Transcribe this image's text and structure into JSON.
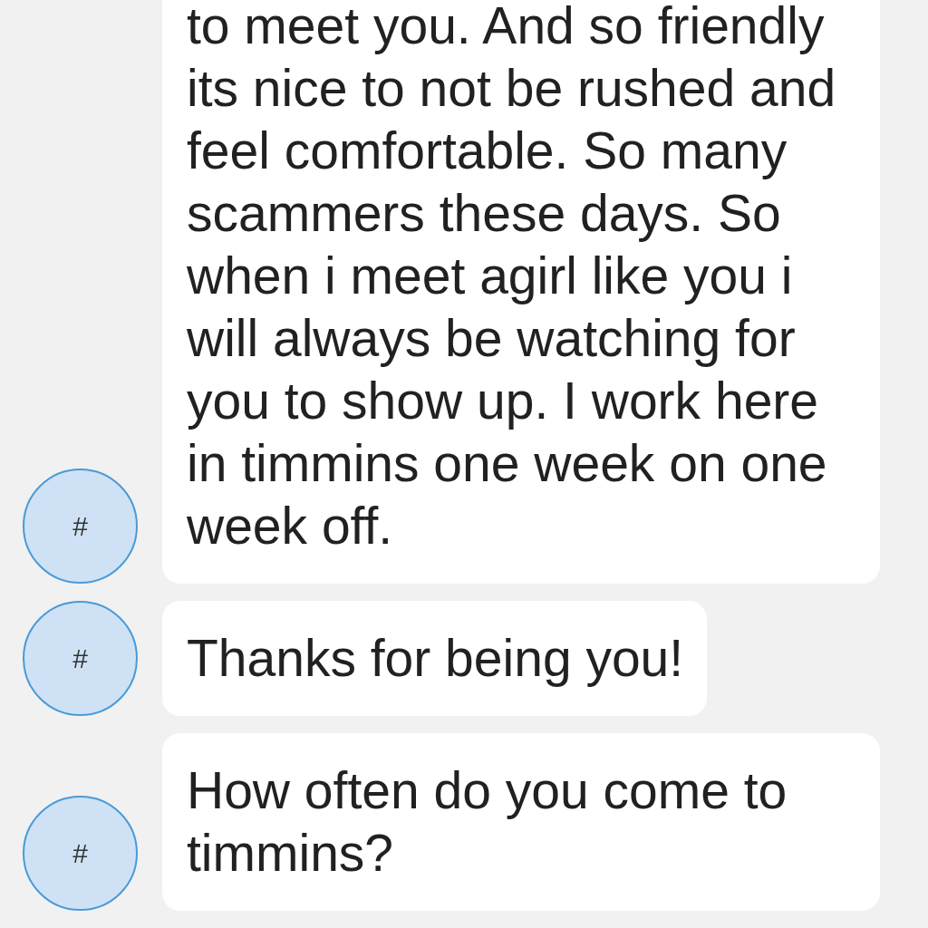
{
  "messages": [
    {
      "avatar": "#",
      "text": "to meet you. And so friendly its nice to not be rushed and feel comfortable. So many scammers these days. So when i meet agirl like you i will always be watching for you to show up. I work here in timmins one week on one week off."
    },
    {
      "avatar": "#",
      "text": "Thanks for being you!"
    },
    {
      "avatar": "#",
      "text": "How often do you come to timmins?"
    }
  ]
}
